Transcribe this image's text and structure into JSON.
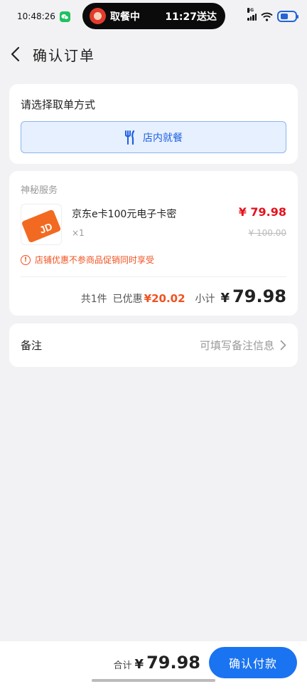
{
  "status_bar": {
    "time": "10:48:26",
    "pill_status": "取餐中",
    "pill_time": "11:27送达",
    "network": "5G"
  },
  "header": {
    "title": "确认订单"
  },
  "pickup": {
    "title": "请选择取单方式",
    "option_label": "店内就餐"
  },
  "order": {
    "section_label": "神秘服务",
    "product": {
      "name": "京东e卡100元电子卡密",
      "qty": "×1",
      "price": "¥ 79.98",
      "original_price": "¥ 100.00",
      "logo_text": "JD"
    },
    "warning": "店铺优惠不参商品促销同时享受",
    "summary": {
      "count": "共1件",
      "discount_label": "已优惠",
      "discount": "¥20.02",
      "subtotal_label": "小计",
      "subtotal_yen": "¥",
      "subtotal": "79.98"
    }
  },
  "remark": {
    "label": "备注",
    "placeholder": "可填写备注信息"
  },
  "bottom": {
    "total_label": "合计",
    "total_yen": "¥",
    "total": "79.98",
    "pay_button": "确认付款"
  },
  "colors": {
    "accent": "#1a73f0",
    "price_red": "#e4121d",
    "discount_orange": "#f0521f",
    "card_orange": "#f26a21"
  },
  "icons": [
    "wechat-icon",
    "back-icon",
    "fork-knife-icon",
    "warning-icon",
    "chevron-right-icon",
    "wifi-icon",
    "battery-icon"
  ]
}
